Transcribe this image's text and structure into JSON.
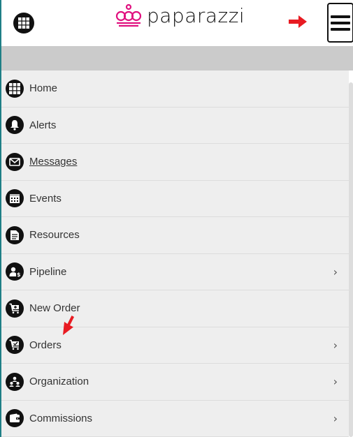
{
  "header": {
    "brand": "paparazzi",
    "apps_icon": "apps-grid-icon",
    "menu_icon": "hamburger-icon",
    "accent_color": "#e0117f",
    "annotation_color": "#e81b22"
  },
  "nav": {
    "items": [
      {
        "label": "Home",
        "icon": "grid-icon",
        "chevron": false,
        "underline": false
      },
      {
        "label": "Alerts",
        "icon": "bell-icon",
        "chevron": false,
        "underline": false
      },
      {
        "label": "Messages",
        "icon": "envelope-icon",
        "chevron": false,
        "underline": true
      },
      {
        "label": "Events",
        "icon": "calendar-icon",
        "chevron": false,
        "underline": false
      },
      {
        "label": "Resources",
        "icon": "document-icon",
        "chevron": false,
        "underline": false
      },
      {
        "label": "Pipeline",
        "icon": "person-dollar-icon",
        "chevron": true,
        "underline": false
      },
      {
        "label": "New Order",
        "icon": "cart-plus-icon",
        "chevron": false,
        "underline": false
      },
      {
        "label": "Orders",
        "icon": "cart-check-icon",
        "chevron": true,
        "underline": false
      },
      {
        "label": "Organization",
        "icon": "org-chart-icon",
        "chevron": true,
        "underline": false
      },
      {
        "label": "Commissions",
        "icon": "wallet-icon",
        "chevron": true,
        "underline": false
      }
    ],
    "chevron_glyph": "›"
  }
}
